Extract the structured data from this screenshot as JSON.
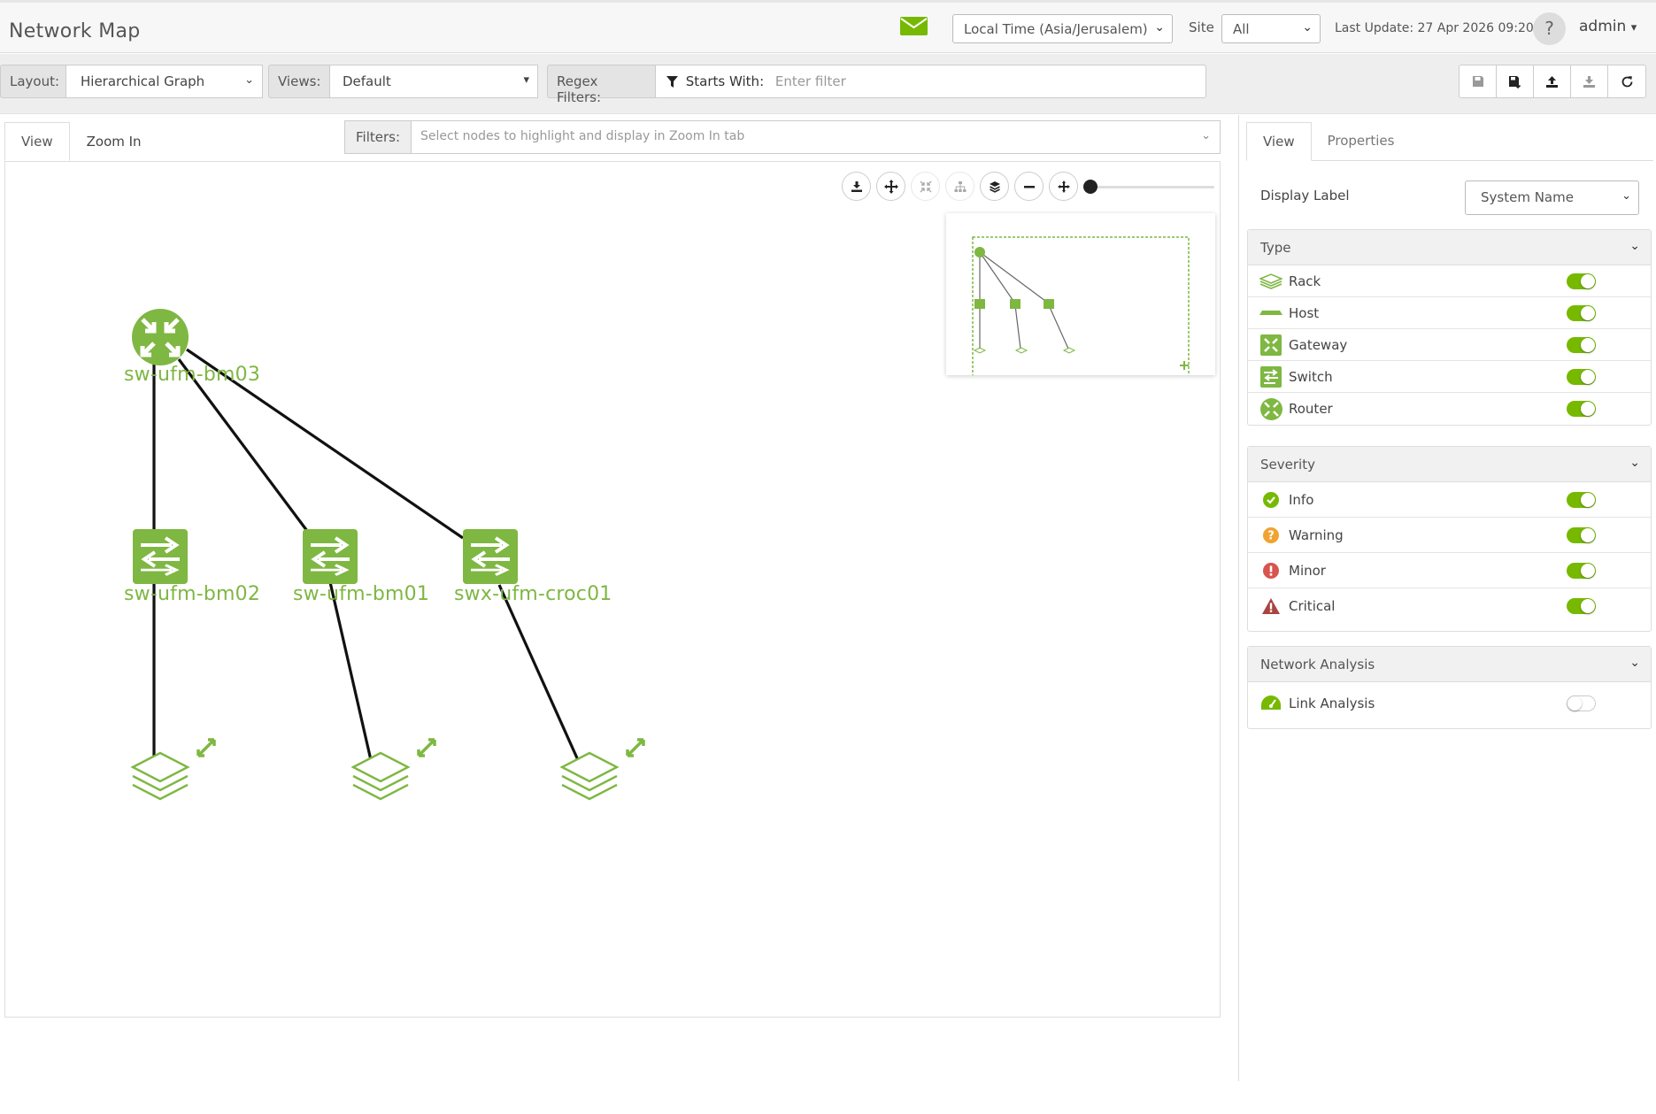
{
  "header": {
    "title": "Network Map",
    "timezone_value": "Local Time (Asia/Jerusalem)",
    "site_label": "Site",
    "site_value": "All",
    "last_update": "Last Update: 27 Apr 2026 09:20",
    "help": "?",
    "user": "admin"
  },
  "toolbar": {
    "layout_label": "Layout:",
    "layout_value": "Hierarchical Graph",
    "views_label": "Views:",
    "views_value": "Default",
    "regex_label": "Regex Filters:",
    "starts_with_label": "Starts With:",
    "filter_placeholder": "Enter filter",
    "actions": [
      "save-icon",
      "save-as-icon",
      "upload-icon",
      "download-icon",
      "refresh-icon"
    ]
  },
  "left_tabs": [
    "View",
    "Zoom In"
  ],
  "filters": {
    "label": "Filters:",
    "placeholder": "Select nodes to highlight and display in Zoom In tab"
  },
  "graph_controls": [
    "download-icon",
    "move-icon",
    "collapse-icon",
    "hierarchy-icon",
    "layers-icon",
    "zoom-out-icon",
    "zoom-in-icon"
  ],
  "zoom_level": 0,
  "graph": {
    "nodes": [
      {
        "id": "sw-ufm-bm03",
        "type": "router",
        "label": "sw-ufm-bm03"
      },
      {
        "id": "sw-ufm-bm02",
        "type": "switch",
        "label": "sw-ufm-bm02"
      },
      {
        "id": "sw-ufm-bm01",
        "type": "switch",
        "label": "sw-ufm-bm01"
      },
      {
        "id": "swx-ufm-croc01",
        "type": "switch",
        "label": "swx-ufm-croc01"
      },
      {
        "id": "rack-1",
        "type": "rack",
        "label": ""
      },
      {
        "id": "rack-2",
        "type": "rack",
        "label": ""
      },
      {
        "id": "rack-3",
        "type": "rack",
        "label": ""
      }
    ],
    "edges": [
      [
        "sw-ufm-bm03",
        "sw-ufm-bm02"
      ],
      [
        "sw-ufm-bm03",
        "sw-ufm-bm01"
      ],
      [
        "sw-ufm-bm03",
        "swx-ufm-croc01"
      ],
      [
        "sw-ufm-bm02",
        "rack-1"
      ],
      [
        "sw-ufm-bm01",
        "rack-2"
      ],
      [
        "swx-ufm-croc01",
        "rack-3"
      ]
    ]
  },
  "right_panel": {
    "tabs": [
      "View",
      "Properties"
    ],
    "display_label": "Display Label",
    "display_value": "System Name",
    "sections": {
      "type": {
        "title": "Type",
        "items": [
          {
            "label": "Rack",
            "icon": "rack-icon",
            "on": true
          },
          {
            "label": "Host",
            "icon": "host-icon",
            "on": true
          },
          {
            "label": "Gateway",
            "icon": "gateway-icon",
            "on": true
          },
          {
            "label": "Switch",
            "icon": "switch-icon",
            "on": true
          },
          {
            "label": "Router",
            "icon": "router-icon",
            "on": true
          }
        ]
      },
      "severity": {
        "title": "Severity",
        "items": [
          {
            "label": "Info",
            "icon": "info-icon",
            "on": true
          },
          {
            "label": "Warning",
            "icon": "warning-icon",
            "on": true
          },
          {
            "label": "Minor",
            "icon": "minor-icon",
            "on": true
          },
          {
            "label": "Critical",
            "icon": "critical-icon",
            "on": true
          }
        ]
      },
      "analysis": {
        "title": "Network Analysis",
        "items": [
          {
            "label": "Link Analysis",
            "icon": "gauge-icon",
            "on": false
          }
        ]
      }
    }
  },
  "colors": {
    "accent": "#76b900",
    "node_green": "#7eb742",
    "warning": "#f0a330",
    "minor": "#d9534f",
    "critical": "#a94442"
  }
}
